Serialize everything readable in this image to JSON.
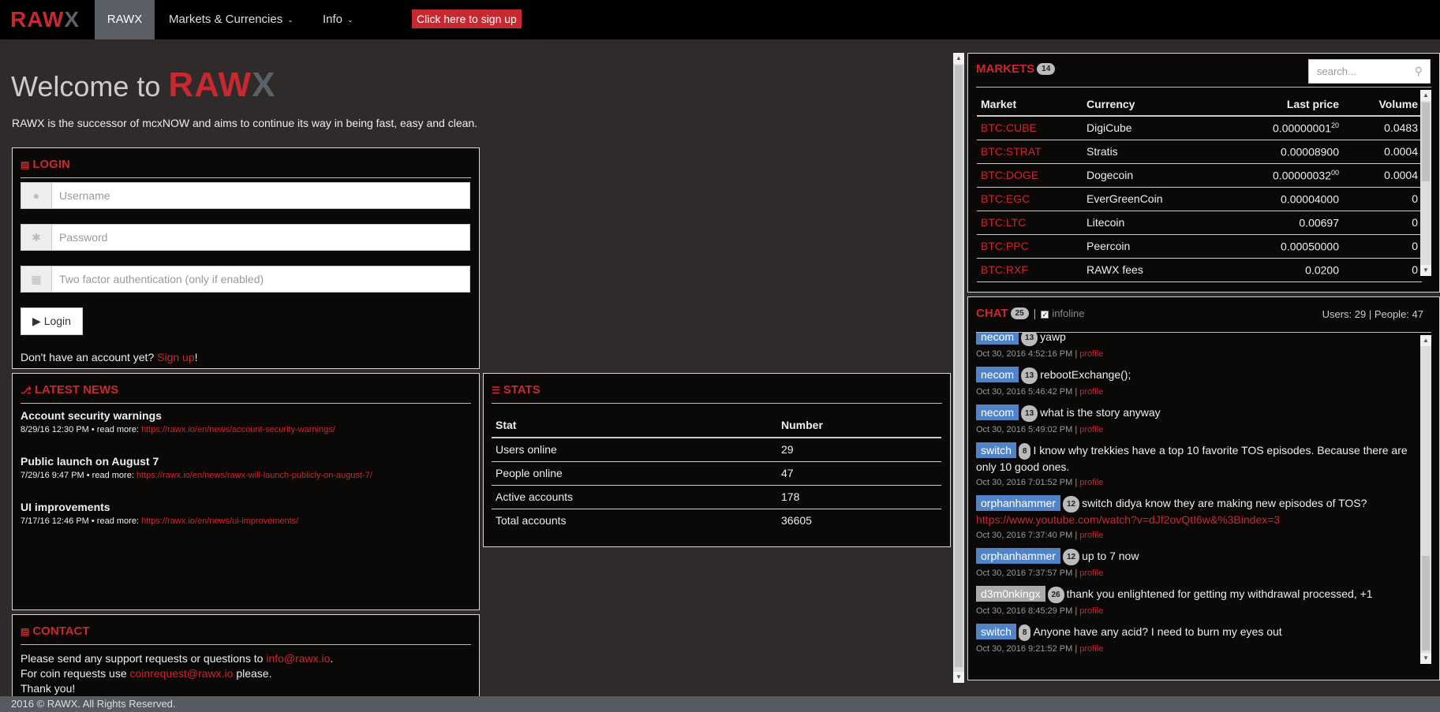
{
  "nav": {
    "brand_r": "RAW",
    "brand_x": "X",
    "home": "RAWX",
    "markets": "Markets & Currencies",
    "info": "Info",
    "signup": "Click here to sign up"
  },
  "welcome": {
    "prefix": "Welcome to ",
    "logo_r": "RAW",
    "logo_x": "X",
    "intro": "RAWX is the successor of mcxNOW and aims to continue its way in being fast, easy and clean."
  },
  "login": {
    "title": "LOGIN",
    "username_placeholder": "Username",
    "password_placeholder": "Password",
    "twofa_placeholder": "Two factor authentication (only if enabled)",
    "button": "Login",
    "noacct_prefix": "Don't have an account yet? ",
    "noacct_link": "Sign up",
    "noacct_suffix": "!"
  },
  "news": {
    "title": "LATEST NEWS",
    "items": [
      {
        "title": "Account security warnings",
        "meta": "8/29/16 12:30 PM • read more: ",
        "link": "https://rawx.io/en/news/account-security-warnings/"
      },
      {
        "title": "Public launch on August 7",
        "meta": "7/29/16 9:47 PM • read more: ",
        "link": "https://rawx.io/en/news/rawx-will-launch-publicly-on-august-7/"
      },
      {
        "title": "UI improvements",
        "meta": "7/17/16 12:46 PM • read more: ",
        "link": "https://rawx.io/en/news/ui-improvements/"
      }
    ]
  },
  "stats": {
    "title": "STATS",
    "headers": [
      "Stat",
      "Number"
    ],
    "rows": [
      [
        "Users online",
        "29"
      ],
      [
        "People online",
        "47"
      ],
      [
        "Active accounts",
        "178"
      ],
      [
        "Total accounts",
        "36605"
      ]
    ]
  },
  "contact": {
    "title": "CONTACT",
    "line1_prefix": "Please send any support requests or questions to ",
    "line1_email": "info@rawx.io",
    "line1_suffix": ".",
    "line2_prefix": "For coin requests use ",
    "line2_email": "coinrequest@rawx.io",
    "line2_suffix": " please.",
    "line3": "Thank you!"
  },
  "markets": {
    "title": "MARKETS",
    "count": "14",
    "search_placeholder": "search...",
    "headers": [
      "Market",
      "Currency",
      "Last price",
      "Volume"
    ],
    "rows": [
      {
        "market": "BTC:CUBE",
        "currency": "DigiCube",
        "price": "0.00000001",
        "price_sup": "20",
        "volume": "0.0483"
      },
      {
        "market": "BTC:STRAT",
        "currency": "Stratis",
        "price": "0.00008900",
        "price_sup": "",
        "volume": "0.0004"
      },
      {
        "market": "BTC:DOGE",
        "currency": "Dogecoin",
        "price": "0.00000032",
        "price_sup": "00",
        "volume": "0.0004"
      },
      {
        "market": "BTC:EGC",
        "currency": "EverGreenCoin",
        "price": "0.00004000",
        "price_sup": "",
        "volume": "0"
      },
      {
        "market": "BTC:LTC",
        "currency": "Litecoin",
        "price": "0.00697",
        "price_sup": "",
        "volume": "0"
      },
      {
        "market": "BTC:PPC",
        "currency": "Peercoin",
        "price": "0.00050000",
        "price_sup": "",
        "volume": "0"
      },
      {
        "market": "BTC:RXF",
        "currency": "RAWX fees",
        "price": "0.0200",
        "price_sup": "",
        "volume": "0"
      }
    ]
  },
  "chat": {
    "title": "CHAT",
    "count": "25",
    "infoline": "infoline",
    "users": "Users: 29 | People: 47",
    "profile": "profile",
    "messages": [
      {
        "user": "necom",
        "rank": "13",
        "text": "yawp",
        "time": "Oct 30, 2016 4:52:16 PM",
        "link": "",
        "color": "blue"
      },
      {
        "user": "necom",
        "rank": "13",
        "text": "rebootExchange();",
        "time": "Oct 30, 2016 5:46:42 PM",
        "link": "",
        "color": "blue"
      },
      {
        "user": "necom",
        "rank": "13",
        "text": "what is the story anyway",
        "time": "Oct 30, 2016 5:49:02 PM",
        "link": "",
        "color": "blue"
      },
      {
        "user": "switch",
        "rank": "8",
        "text": "I know why trekkies have a top 10 favorite TOS episodes. Because there are only 10 good ones.",
        "time": "Oct 30, 2016 7:01:52 PM",
        "link": "",
        "color": "blue"
      },
      {
        "user": "orphanhammer",
        "rank": "12",
        "text": "switch didya know they are making new episodes of TOS?",
        "time": "Oct 30, 2016 7:37:40 PM",
        "link": "https://www.youtube.com/watch?v=dJf2ovQtI6w&%3Bindex=3",
        "color": "blue"
      },
      {
        "user": "orphanhammer",
        "rank": "12",
        "text": "up to 7 now",
        "time": "Oct 30, 2016 7:37:57 PM",
        "link": "",
        "color": "blue"
      },
      {
        "user": "d3m0nkingx",
        "rank": "26",
        "text": "thank you enlightened for getting my withdrawal processed, +1",
        "time": "Oct 30, 2016 8:45:29 PM",
        "link": "",
        "color": "gray"
      },
      {
        "user": "switch",
        "rank": "8",
        "text": "Anyone have any acid? I need to burn my eyes out",
        "time": "Oct 30, 2016 9:21:52 PM",
        "link": "",
        "color": "blue"
      }
    ]
  },
  "footer": "2016 © RAWX. All Rights Reserved."
}
